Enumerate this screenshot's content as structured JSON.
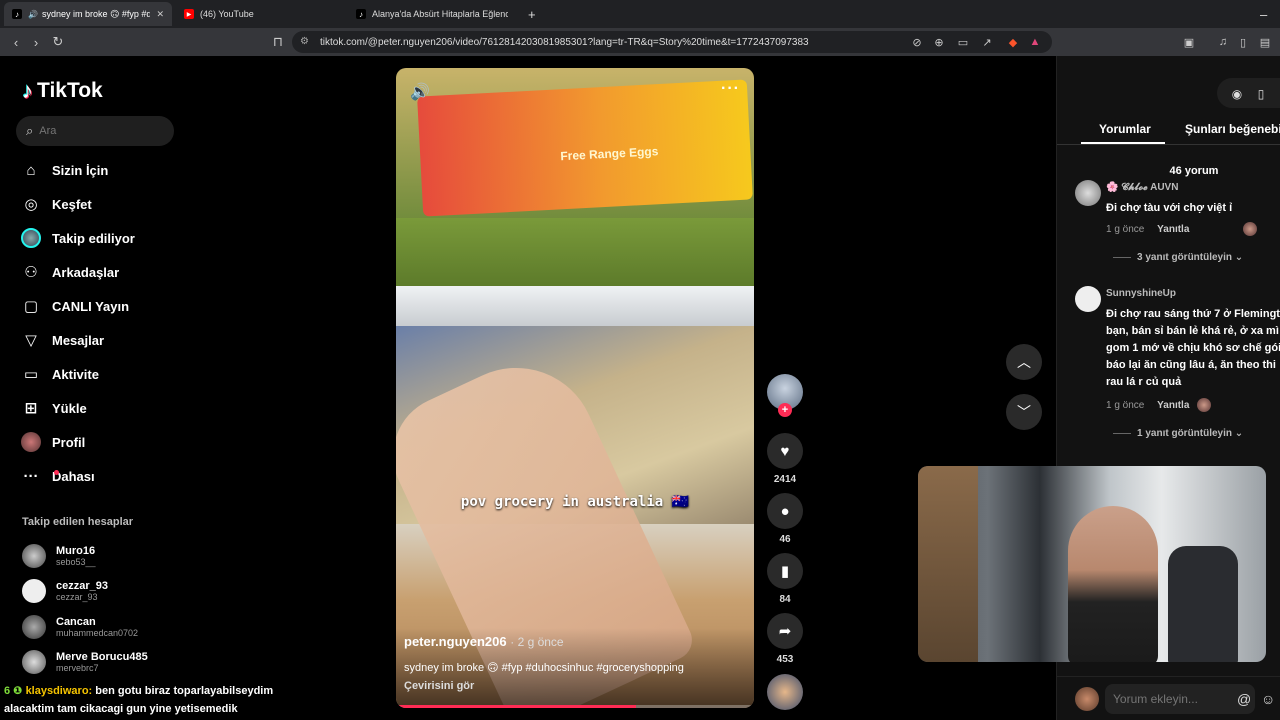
{
  "browser": {
    "tabs": [
      {
        "title": "sydney im broke 🙃 #fyp #du",
        "active": true
      },
      {
        "title": "(46) YouTube",
        "active": false
      },
      {
        "title": "Alanya'da Absürt Hitaplarla Eğlenceli",
        "active": false
      }
    ],
    "url": "tiktok.com/@peter.nguyen206/video/7612814203081985301?lang=tr-TR&q=Story%20time&t=1772437097383"
  },
  "sidebar": {
    "logo": "TikTok",
    "search_placeholder": "Ara",
    "nav": [
      {
        "label": "Sizin İçin",
        "icon": "home-icon"
      },
      {
        "label": "Keşfet",
        "icon": "compass-icon"
      },
      {
        "label": "Takip ediliyor",
        "icon": "avatar-icon"
      },
      {
        "label": "Arkadaşlar",
        "icon": "friends-icon"
      },
      {
        "label": "CANLI Yayın",
        "icon": "live-icon"
      },
      {
        "label": "Mesajlar",
        "icon": "message-icon"
      },
      {
        "label": "Aktivite",
        "icon": "activity-icon"
      },
      {
        "label": "Yükle",
        "icon": "upload-icon"
      },
      {
        "label": "Profil",
        "icon": "profile-icon"
      },
      {
        "label": "Dahası",
        "icon": "more-icon"
      }
    ],
    "following_title": "Takip edilen hesaplar",
    "following": [
      {
        "name": "Muro16",
        "handle": "sebo53__"
      },
      {
        "name": "cezzar_93",
        "handle": "cezzar_93"
      },
      {
        "name": "Cancan",
        "handle": "muhammedcan0702"
      },
      {
        "name": "Merve Borucu485",
        "handle": "mervebrc7"
      }
    ]
  },
  "video": {
    "overlay_text": "pov grocery in australia 🇦🇺",
    "box_label": "Free Range Eggs",
    "author": "peter.nguyen206",
    "ago": "· 2 g önce",
    "description": "sydney im broke 🙃 #fyp #duhocsinhuc #groceryshopping",
    "translate": "Çevirisini gör",
    "progress": 0.67
  },
  "actions": {
    "likes": "2414",
    "comments": "46",
    "saves": "84",
    "shares": "453"
  },
  "comments": {
    "tabs": [
      "Yorumlar",
      "Şunları beğenebilirsin"
    ],
    "count": "46 yorum",
    "items": [
      {
        "user": "🌸 𝓒𝓱𝓵𝓸𝓮 AUVN",
        "text": [
          "Đi chợ tàu với chợ việt ỉ"
        ],
        "ago": "1 g önce",
        "reply": "Yanıtla",
        "replies": "3 yanıt görüntüleyin"
      },
      {
        "user": "SunnyshineUp",
        "text": [
          "Đi chợ rau sáng thứ 7 ở Flemingt",
          "bạn, bán sỉ bán lẻ khá rẻ, ở xa mì",
          "gom 1 mớ về chịu khó sơ chế gói",
          "báo lại ăn cũng lâu á, ăn theo thi",
          "rau lá r củ quả"
        ],
        "ago": "1 g önce",
        "reply": "Yanıtla",
        "replies": "1 yanıt görüntüleyin"
      }
    ],
    "input_placeholder": "Yorum ekleyin..."
  },
  "chat": {
    "badge": "6 ❶",
    "name": "klaysdiwaro:",
    "line1": "ben gotu biraz toparlayabilseydim",
    "line2": "alacaktim tam cikacagi gun yine yetisemedik"
  }
}
